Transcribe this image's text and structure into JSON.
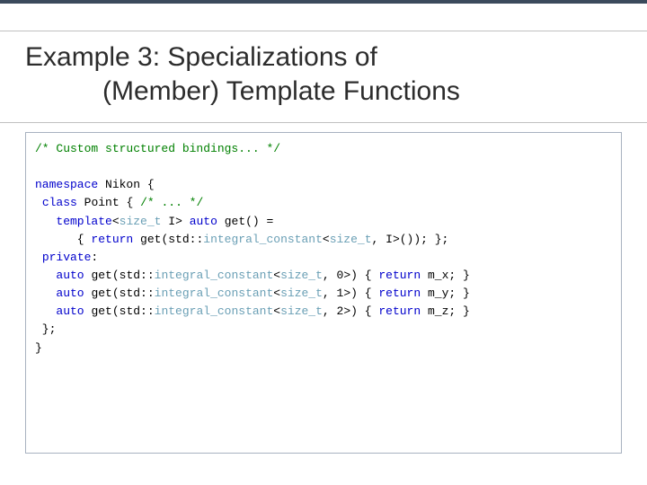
{
  "title": {
    "line1": "Example 3: Specializations of",
    "line2": "(Member) Template Functions"
  },
  "code": {
    "c1": "/* Custom structured bindings... */",
    "c2": "/* ... */",
    "kw_namespace": "namespace",
    "kw_class": "class",
    "kw_template": "template",
    "kw_auto": "auto",
    "kw_return": "return",
    "kw_private": "private",
    "ns": "Nikon",
    "cls": "Point",
    "ty_size_t": "size_t",
    "ty_ic": "integral_constant",
    "tpl_param": "I",
    "fn_get": "get",
    "n0": "0",
    "n1": "1",
    "n2": "2",
    "mx": "m_x",
    "my": "m_y",
    "mz": "m_z"
  }
}
